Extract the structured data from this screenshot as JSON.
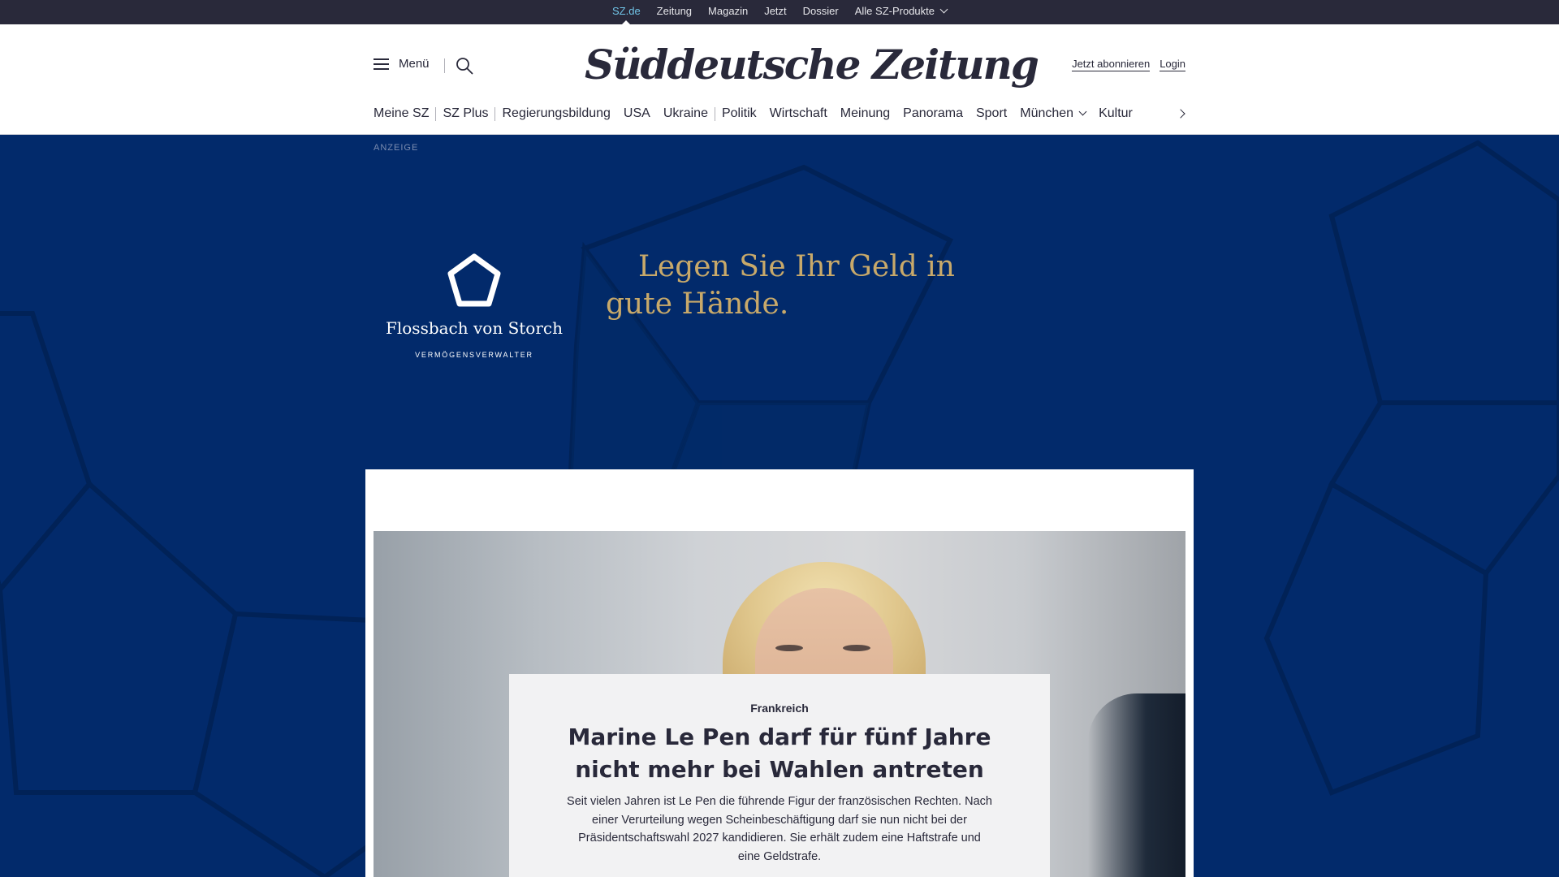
{
  "topbar": {
    "items": [
      {
        "label": "SZ.de",
        "active": true
      },
      {
        "label": "Zeitung"
      },
      {
        "label": "Magazin"
      },
      {
        "label": "Jetzt"
      },
      {
        "label": "Dossier"
      },
      {
        "label": "Alle SZ-Produkte",
        "dropdown": true
      }
    ]
  },
  "header": {
    "menu_label": "Menü",
    "logo_text": "Süddeutsche Zeitung",
    "subscribe_label": "Jetzt abonnieren",
    "login_label": "Login"
  },
  "sections": {
    "items": [
      "Meine SZ",
      "SZ Plus",
      "Regierungsbildung",
      "USA",
      "Ukraine",
      "Politik",
      "Wirtschaft",
      "Meinung",
      "Panorama",
      "Sport",
      "München",
      "Kultur"
    ]
  },
  "ad": {
    "label": "ANZEIGE",
    "brand": "Flossbach von Storch",
    "brand_sub": "VERMÖGENSVERWALTER",
    "claim": "Legen Sie Ihr Geld in gute Hände.",
    "colors": {
      "background": "#022a6b",
      "claim": "#c8a96a"
    }
  },
  "teaser": {
    "kicker": "Frankreich",
    "title": "Marine Le Pen darf für fünf Jahre nicht mehr bei Wahlen antreten",
    "text": "Seit vielen Jahren ist Le Pen die führende Figur der französischen Rechten. Nach einer Verurteilung wegen Scheinbeschäftigung darf sie nun nicht bei der Präsidentschaftswahl 2027 kandidieren. Sie erhält zudem eine Haftstrafe und eine Geldstrafe."
  },
  "colors": {
    "text": "#29293a",
    "topbar": "#29293a",
    "active_link": "#71c5e8"
  }
}
